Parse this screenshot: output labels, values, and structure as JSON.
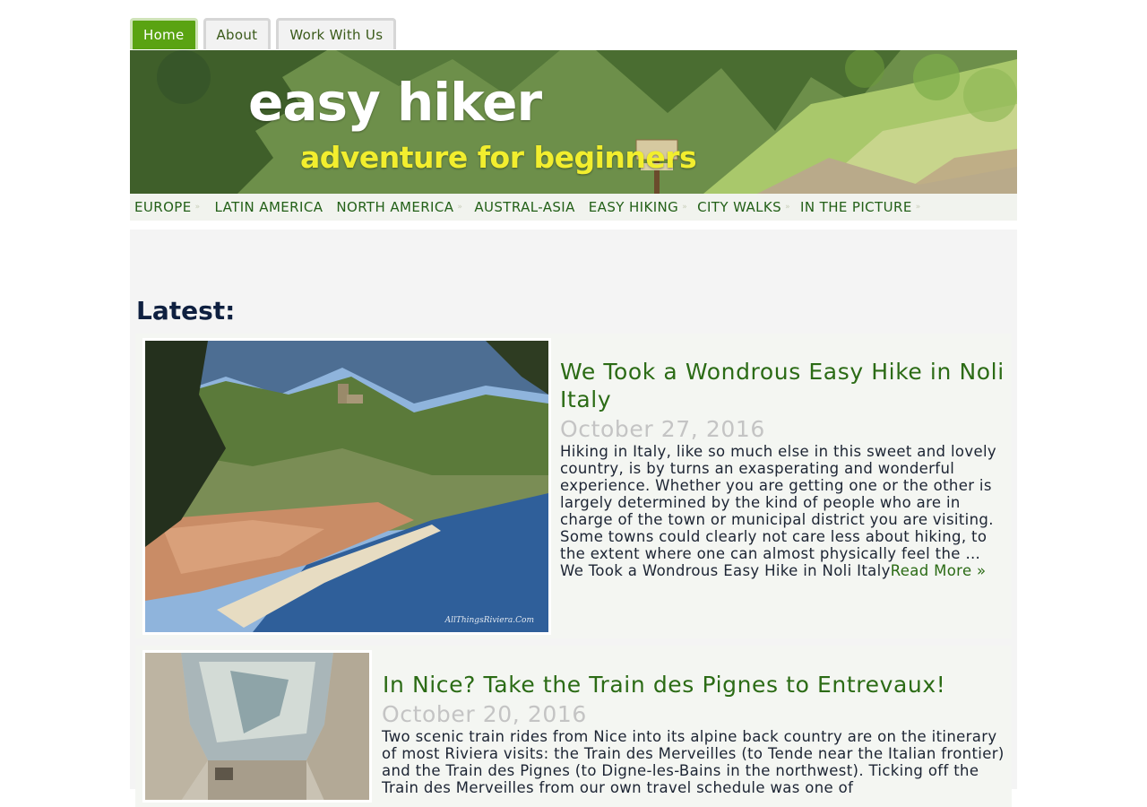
{
  "top_tabs": [
    "Home",
    "About",
    "Work With Us"
  ],
  "banner": {
    "title": "easy hiker",
    "tagline": "adventure for beginners"
  },
  "main_nav": [
    {
      "label": "EUROPE",
      "has_submenu": true
    },
    {
      "label": "LATIN AMERICA",
      "has_submenu": false
    },
    {
      "label": "NORTH AMERICA",
      "has_submenu": true
    },
    {
      "label": "AUSTRAL-ASIA",
      "has_submenu": false
    },
    {
      "label": "EASY HIKING",
      "has_submenu": true
    },
    {
      "label": "CITY WALKS",
      "has_submenu": true
    },
    {
      "label": "IN THE PICTURE",
      "has_submenu": true
    }
  ],
  "section_heading": "Latest:",
  "posts": [
    {
      "title": "We Took a Wondrous Easy Hike in Noli Italy",
      "date": "October 27, 2016",
      "excerpt": "Hiking in Italy, like so much else in this sweet and lovely country, is by turns an exasperating and wonderful experience. Whether you are getting one or the other is largely determined by the kind of people who are in charge of the town or municipal district you are visiting. Some towns could clearly not care less about hiking, to the extent where one can almost physically feel the …",
      "excerpt_tail": "We Took a Wondrous Easy Hike in Noli Italy",
      "read_more": "Read More »",
      "image_watermark": "AllThingsRiviera.Com"
    },
    {
      "title": "In Nice? Take the Train des Pignes to Entrevaux!",
      "date": "October 20, 2016",
      "excerpt": "Two scenic train rides from Nice into its alpine back country are on the itinerary of most Riviera visits: the Train des Merveilles (to Tende near the Italian frontier) and the Train des Pignes (to Digne-les-Bains in the northwest). Ticking off the Train des Merveilles from our own travel schedule was one of"
    }
  ],
  "colors": {
    "active_tab": "#5aa312",
    "link_green": "#2b6b15",
    "heading_navy": "#0f2040",
    "date_gray": "#c4c4c4"
  }
}
